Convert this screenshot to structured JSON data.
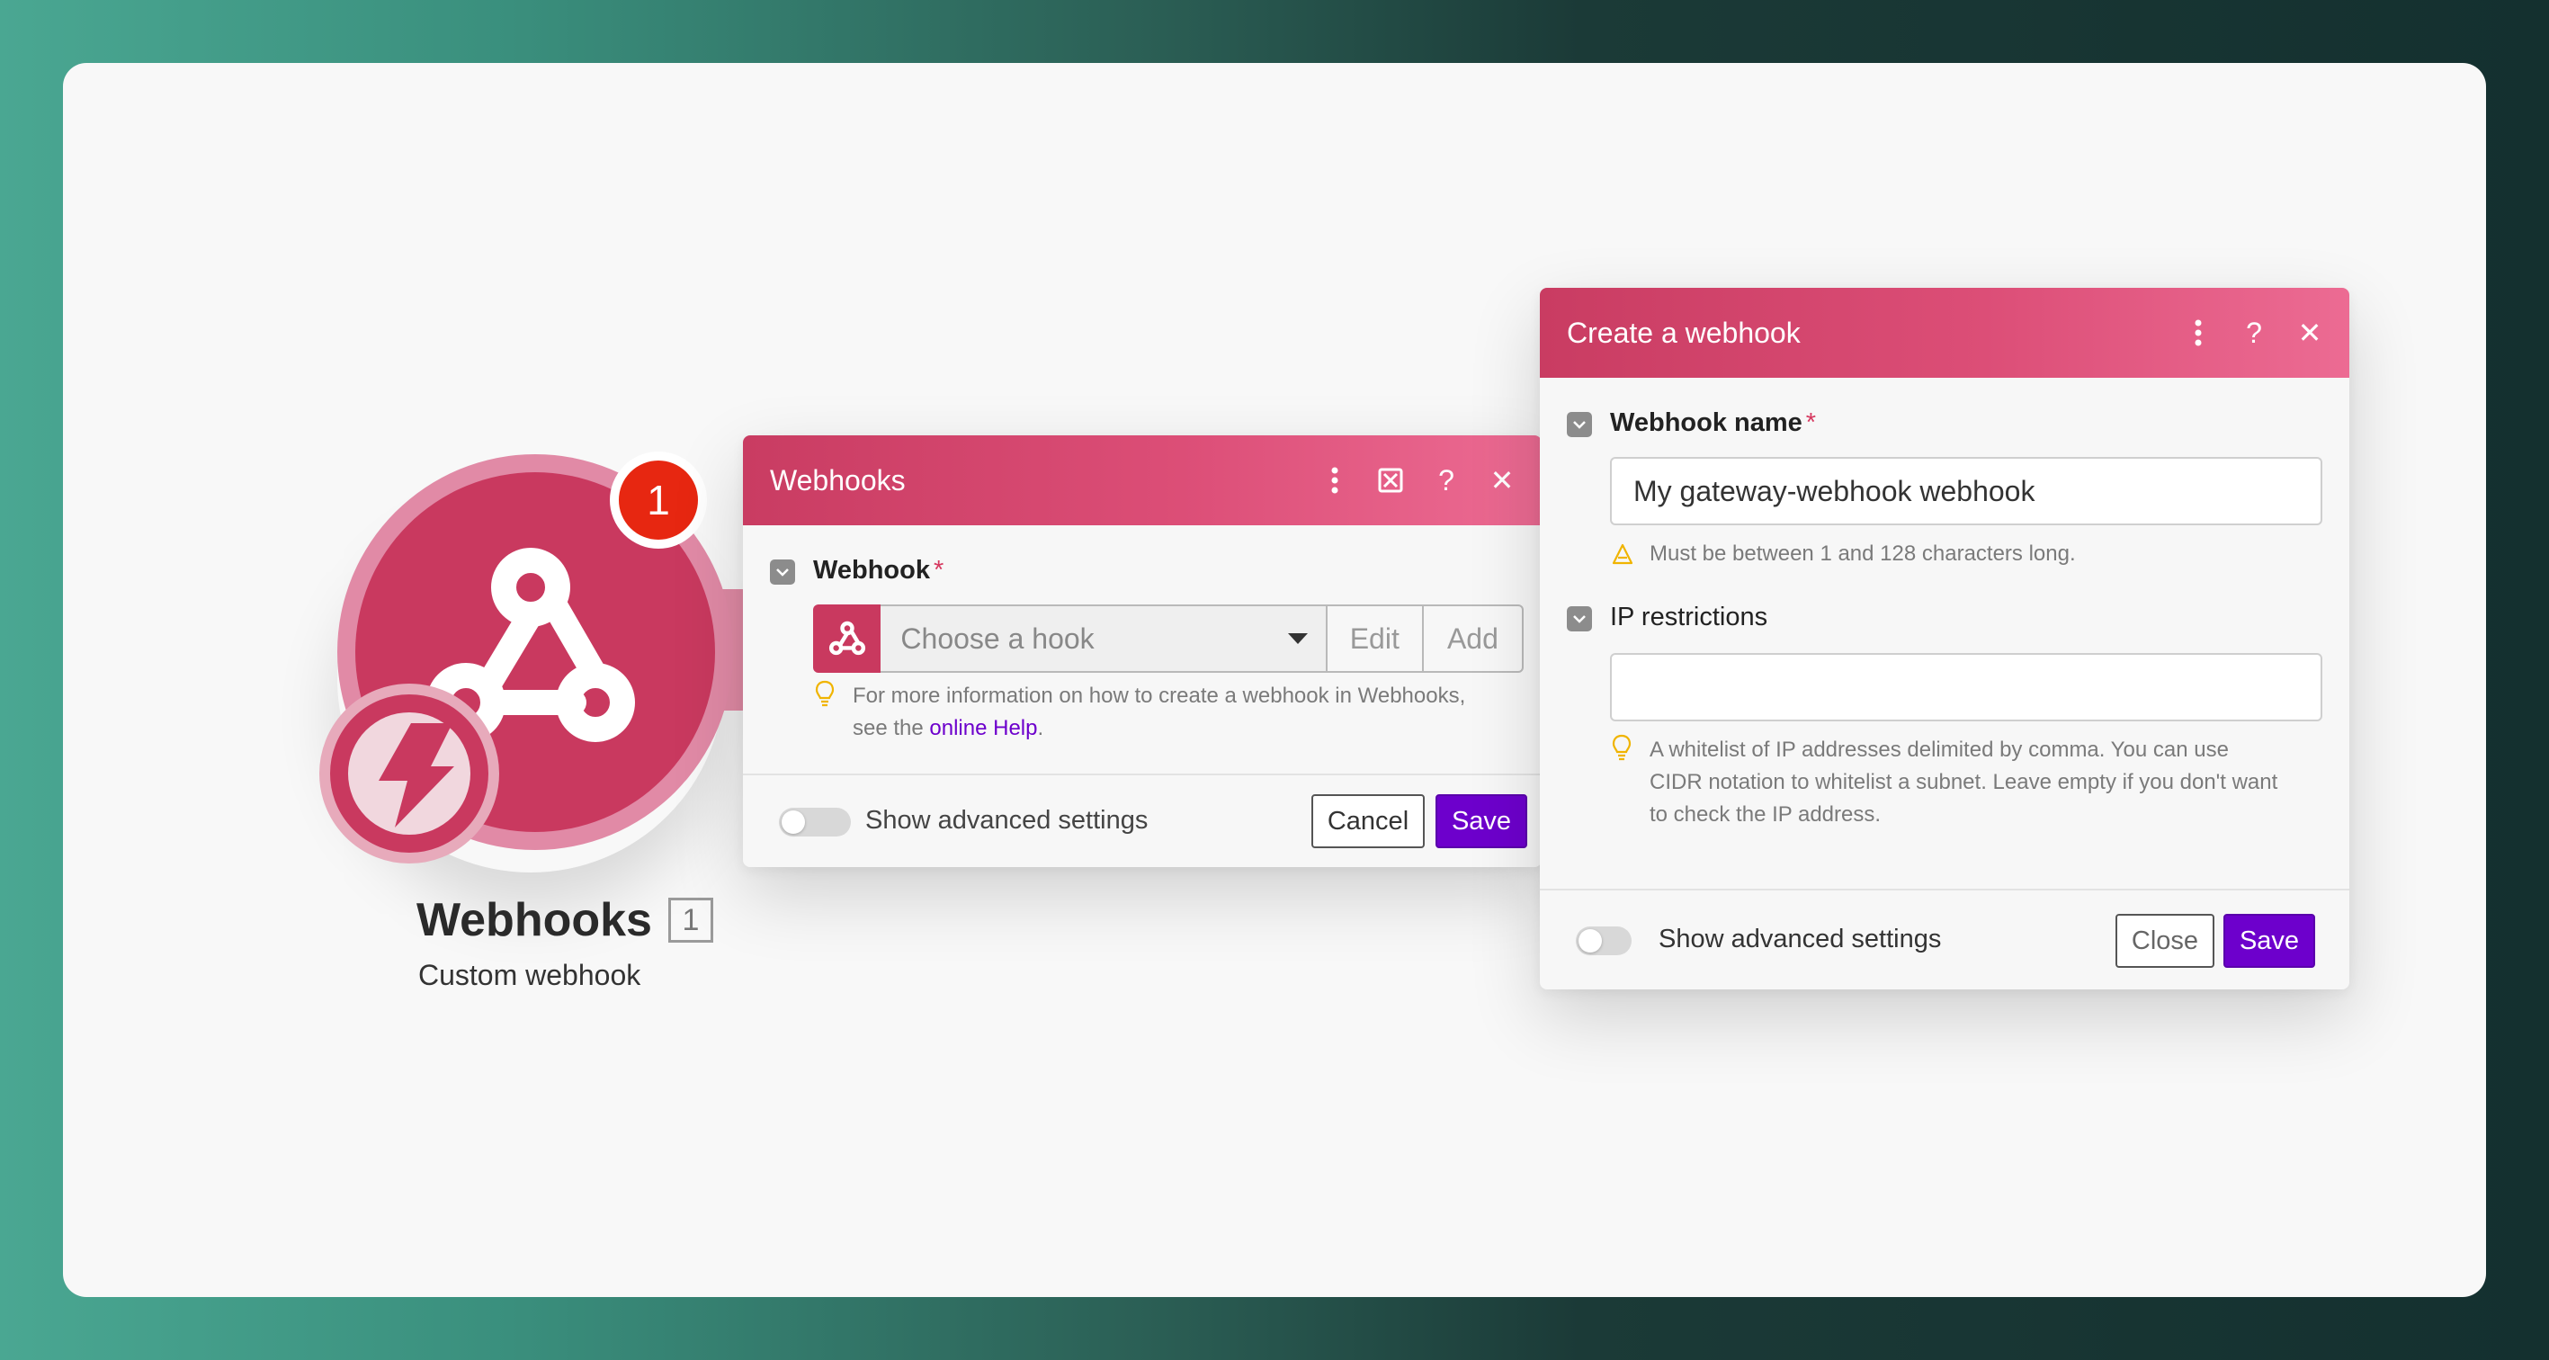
{
  "module": {
    "title": "Webhooks",
    "subtitle": "Custom webhook",
    "count": "1",
    "badge": "1",
    "icon": "webhook-icon",
    "trigger_icon": "lightning-icon",
    "color": "#c9395f"
  },
  "webhooks_dialog": {
    "title": "Webhooks",
    "field_label": "Webhook",
    "required_mark": "*",
    "select_placeholder": "Choose a hook",
    "edit_label": "Edit",
    "add_label": "Add",
    "hint_prefix": "For more information on how to create a webhook in Webhooks,",
    "hint_see": "see the",
    "hint_link": "online Help",
    "hint_suffix": ".",
    "toggle_label": "Show advanced settings",
    "cancel_label": "Cancel",
    "save_label": "Save"
  },
  "create_dialog": {
    "title": "Create a webhook",
    "name_label": "Webhook name",
    "required_mark": "*",
    "name_value": "My gateway-webhook webhook",
    "name_hint": "Must be between 1 and 128 characters long.",
    "ip_label": "IP restrictions",
    "ip_value": "",
    "ip_hint_1": "A whitelist of IP addresses delimited by comma. You can use",
    "ip_hint_2": "CIDR notation to whitelist a subnet. Leave empty if you don't want",
    "ip_hint_3": "to check the IP address.",
    "toggle_label": "Show advanced settings",
    "close_label": "Close",
    "save_label": "Save"
  },
  "colors": {
    "header_start": "#c93c62",
    "header_end": "#ec6b93",
    "primary_button": "#6d00cc",
    "badge": "#e72711"
  }
}
